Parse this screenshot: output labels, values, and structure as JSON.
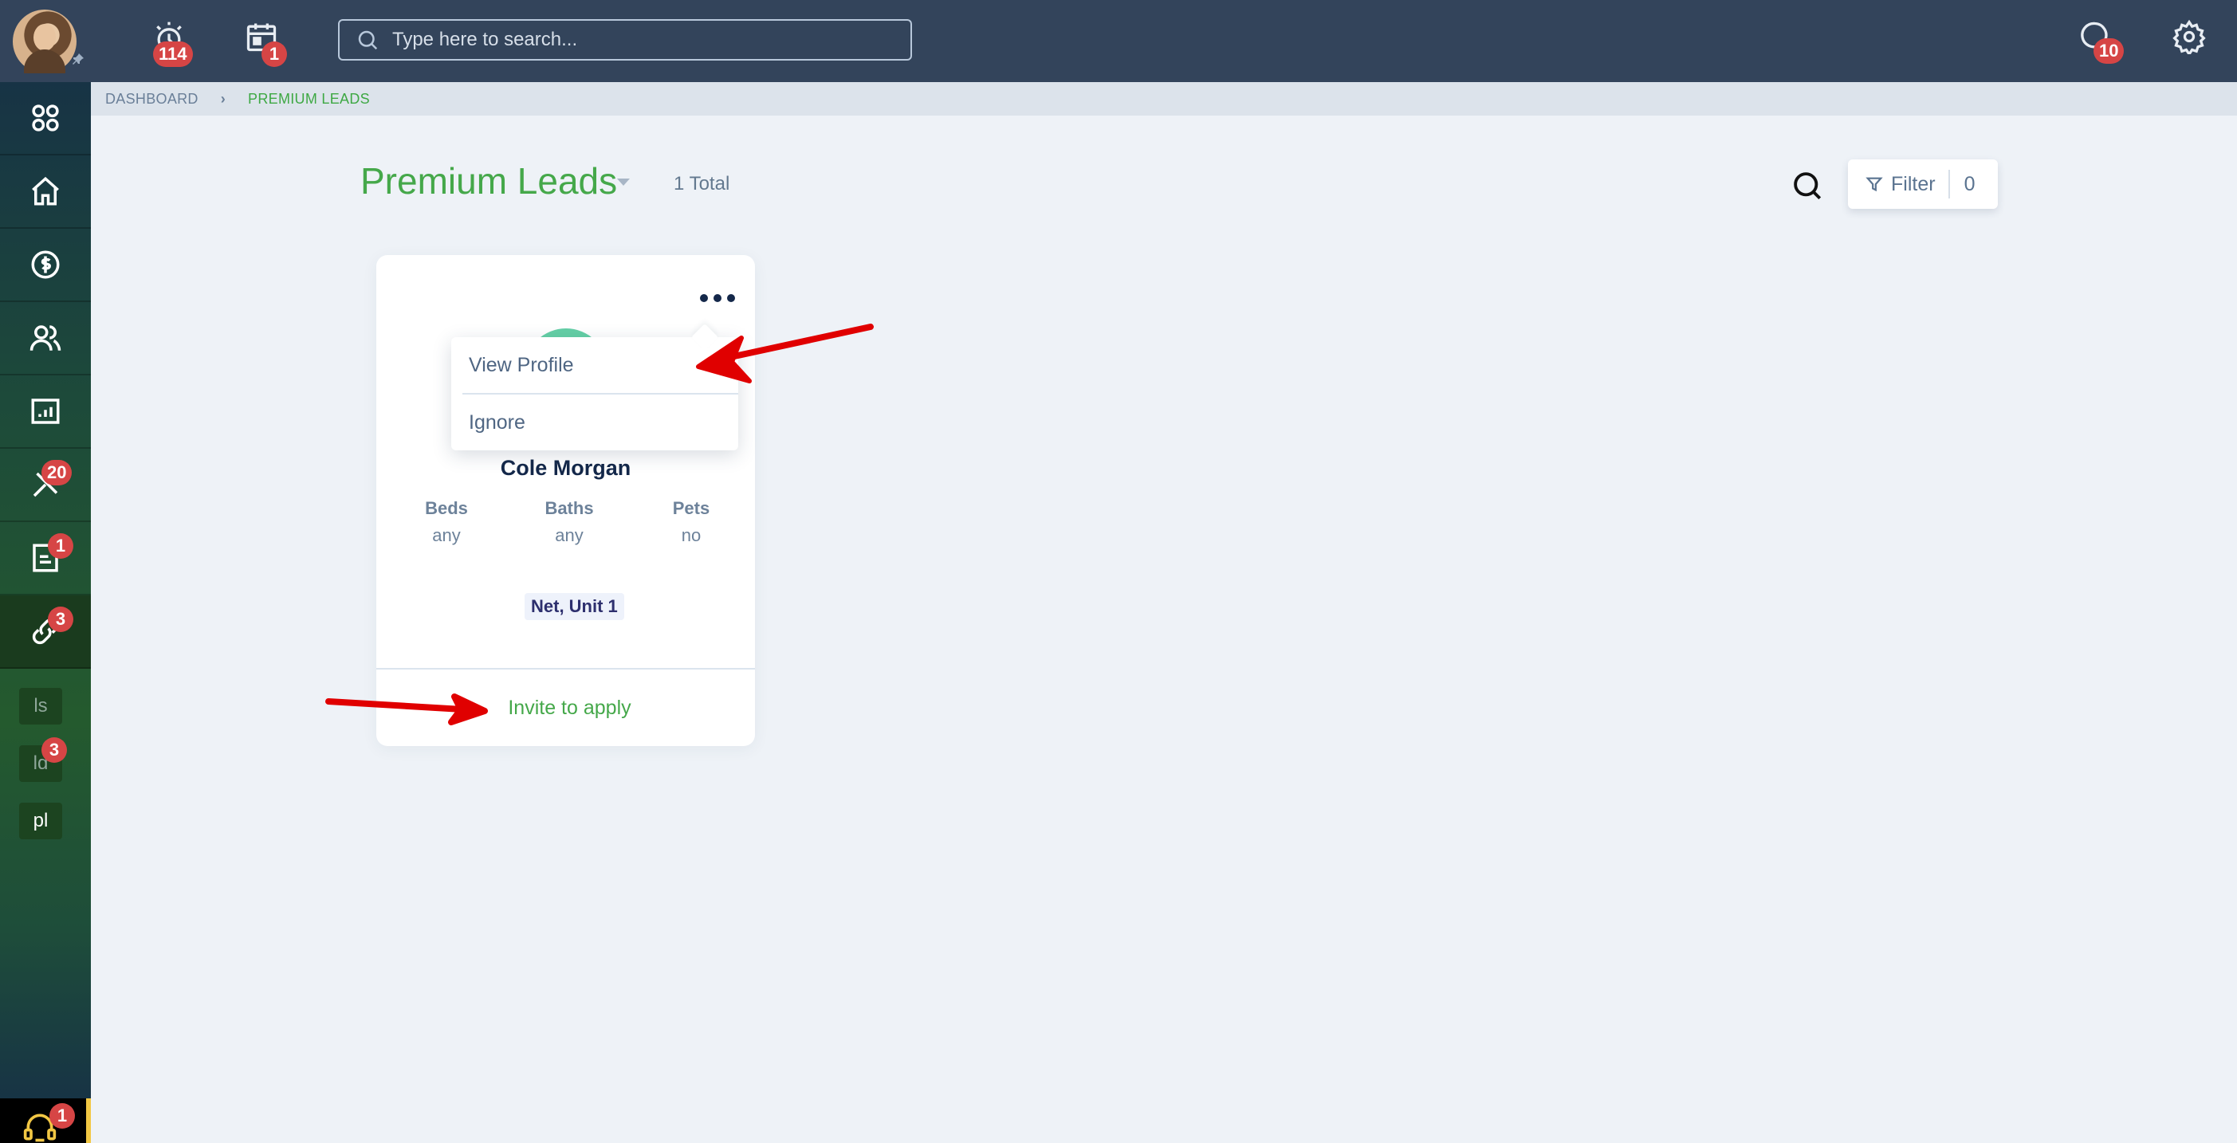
{
  "topbar": {
    "user_avatar_alt": "User avatar",
    "alarm_badge": "114",
    "calendar_badge": "1",
    "search_placeholder": "Type here to search...",
    "messages_badge": "10"
  },
  "sidebar": {
    "items": [
      {
        "name": "apps",
        "badge": null
      },
      {
        "name": "home",
        "badge": null
      },
      {
        "name": "billing",
        "badge": null
      },
      {
        "name": "people",
        "badge": null
      },
      {
        "name": "reports",
        "badge": null
      },
      {
        "name": "maintenance",
        "badge": "20"
      },
      {
        "name": "documents",
        "badge": "1"
      },
      {
        "name": "leads",
        "badge": "3",
        "active": true
      }
    ],
    "sub_items": [
      {
        "label": "ls",
        "badge": null
      },
      {
        "label": "ld",
        "badge": "3"
      },
      {
        "label": "pl",
        "badge": null
      }
    ],
    "support_badge": "1"
  },
  "breadcrumb": {
    "root": "DASHBOARD",
    "current": "PREMIUM LEADS"
  },
  "header": {
    "title": "Premium Leads",
    "total": "1 Total",
    "filter_label": "Filter",
    "filter_count": "0"
  },
  "lead_card": {
    "name": "Cole Morgan",
    "attributes": [
      {
        "label": "Beds",
        "value": "any"
      },
      {
        "label": "Baths",
        "value": "any"
      },
      {
        "label": "Pets",
        "value": "no"
      }
    ],
    "unit": "Net, Unit 1",
    "action": "Invite to apply"
  },
  "context_menu": {
    "items": [
      "View Profile",
      "Ignore"
    ]
  },
  "colors": {
    "topbar": "#33445b",
    "accent_green": "#45a84a",
    "badge_red": "#d64545",
    "avatar_teal": "#64d0a6",
    "annotation_red": "#e00000"
  }
}
